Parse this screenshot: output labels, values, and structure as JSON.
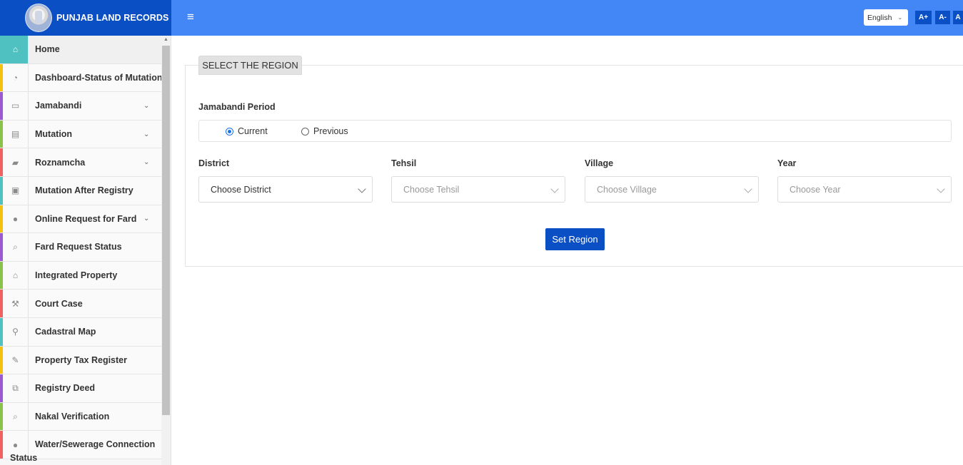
{
  "header": {
    "brand_title": "PUNJAB LAND RECORDS",
    "menu_toggle": "≡",
    "language": "English",
    "font_increase": "A+",
    "font_decrease": "A-",
    "font_reset": "A"
  },
  "sidebar": {
    "items": [
      {
        "label": "Home",
        "icon": "home-icon",
        "glyph": "⌂",
        "color": "#4fc1c1",
        "has_arrow": false,
        "active": true
      },
      {
        "label": "Dashboard-Status of Mutations",
        "icon": "dashboard-icon",
        "glyph": "◔",
        "color": "#f4c20d",
        "has_arrow": false
      },
      {
        "label": "Jamabandi",
        "icon": "id-card-icon",
        "glyph": "▭",
        "color": "#9c59d1",
        "has_arrow": true
      },
      {
        "label": "Mutation",
        "icon": "file-icon",
        "glyph": "▤",
        "color": "#8bc34a",
        "has_arrow": true
      },
      {
        "label": "Roznamcha",
        "icon": "book-icon",
        "glyph": "▰",
        "color": "#f0625f",
        "has_arrow": true
      },
      {
        "label": "Mutation After Registry",
        "icon": "briefcase-icon",
        "glyph": "▣",
        "color": "#4fc1c1",
        "has_arrow": false
      },
      {
        "label": "Online Request for Fard",
        "icon": "drop-icon",
        "glyph": "●",
        "color": "#f4c20d",
        "has_arrow": true
      },
      {
        "label": "Fard Request Status",
        "icon": "search-icon",
        "glyph": "⌕",
        "color": "#9c59d1",
        "has_arrow": false
      },
      {
        "label": "Integrated Property",
        "icon": "bank-icon",
        "glyph": "⌂",
        "color": "#8bc34a",
        "has_arrow": false
      },
      {
        "label": "Court Case",
        "icon": "gavel-icon",
        "glyph": "⚒",
        "color": "#f0625f",
        "has_arrow": false
      },
      {
        "label": "Cadastral Map",
        "icon": "map-marker-icon",
        "glyph": "⚲",
        "color": "#4fc1c1",
        "has_arrow": false
      },
      {
        "label": "Property Tax Register",
        "icon": "edit-icon",
        "glyph": "✎",
        "color": "#f4c20d",
        "has_arrow": false
      },
      {
        "label": "Registry Deed",
        "icon": "copy-icon",
        "glyph": "⧉",
        "color": "#9c59d1",
        "has_arrow": false
      },
      {
        "label": "Nakal Verification",
        "icon": "search-icon",
        "glyph": "⌕",
        "color": "#8bc34a",
        "has_arrow": false
      },
      {
        "label": "Water/Sewerage Connection",
        "label_line2": "Status",
        "icon": "drop-icon",
        "glyph": "●",
        "color": "#f0625f",
        "has_arrow": false
      }
    ]
  },
  "main": {
    "panel_title": "SELECT THE REGION",
    "period_label": "Jamabandi Period",
    "period_options": [
      {
        "label": "Current",
        "selected": true
      },
      {
        "label": "Previous",
        "selected": false
      }
    ],
    "fields": [
      {
        "label": "District",
        "placeholder": "Choose District",
        "enabled": true
      },
      {
        "label": "Tehsil",
        "placeholder": "Choose Tehsil",
        "enabled": false
      },
      {
        "label": "Village",
        "placeholder": "Choose Village",
        "enabled": false
      },
      {
        "label": "Year",
        "placeholder": "Choose Year",
        "enabled": false
      }
    ],
    "submit_label": "Set Region"
  },
  "colors": {
    "topbar": "#4287f5",
    "brand": "#0b4fc4",
    "accent_button": "#0b4fc4",
    "active_menu": "#4fc1c1"
  }
}
